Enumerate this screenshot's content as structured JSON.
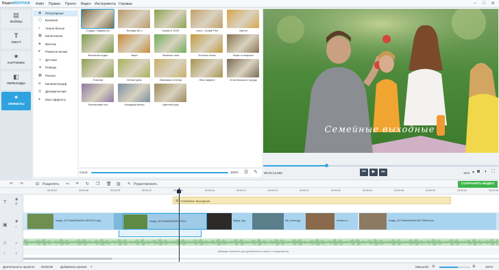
{
  "app": {
    "brand_prefix": "Видео",
    "brand_suffix": "МОНТАЖ",
    "menu": [
      "Файл",
      "Правка",
      "Проект",
      "Видео",
      "Инструменты",
      "Справка"
    ]
  },
  "sidebar": {
    "items": [
      {
        "label": "ФАЙЛЫ",
        "icon": "film-strip-icon"
      },
      {
        "label": "ТЕКСТ",
        "icon": "text-t-icon"
      },
      {
        "label": "КАРТИНКИ",
        "icon": "star-icon"
      },
      {
        "label": "ПЕРЕХОДЫ",
        "icon": "transitions-icon"
      },
      {
        "label": "ЭФФЕКТЫ",
        "icon": "magic-wand-icon"
      }
    ],
    "active": "ЭФФЕКТЫ"
  },
  "categories": [
    {
      "label": "Популярные",
      "icon": "thumb-icon"
    },
    {
      "label": "Базовые",
      "icon": "square-icon"
    },
    {
      "label": "Черно-белые",
      "icon": "circle-half-icon"
    },
    {
      "label": "Кинопленка",
      "icon": "film-icon"
    },
    {
      "label": "Винтаж",
      "icon": "vintage-icon"
    },
    {
      "label": "Романтические",
      "icon": "heart-icon"
    },
    {
      "label": "Детские",
      "icon": "child-icon"
    },
    {
      "label": "Пейзаж",
      "icon": "landscape-icon"
    },
    {
      "label": "Разное",
      "icon": "grid-icon"
    },
    {
      "label": "Кинематограф",
      "icon": "camera-icon"
    },
    {
      "label": "Динамические",
      "icon": "dynamic-icon"
    },
    {
      "label": "Мои эффекты",
      "icon": "user-icon"
    }
  ],
  "effects": [
    {
      "label": "Студия «Эффекты»",
      "color": "#7a6a4a"
    },
    {
      "label": "Фильмы 80-х",
      "color": "#b99a6a"
    },
    {
      "label": "Kodak E-100S",
      "color": "#8ca24e"
    },
    {
      "label": "Lomo - Kodak Film",
      "color": "#c4a06a"
    },
    {
      "label": "Амели",
      "color": "#d6a64a"
    },
    {
      "label": "Весенний отдых",
      "color": "#7c9b4a"
    },
    {
      "label": "Закат",
      "color": "#c78a3a"
    },
    {
      "label": "Зеленые тона",
      "color": "#6fae5a"
    },
    {
      "label": "Золотая осень",
      "color": "#c29a3e"
    },
    {
      "label": "Кофе и сигареты",
      "color": "#8a7350"
    },
    {
      "label": "Позитив",
      "color": "#8ea052"
    },
    {
      "label": "Летний день",
      "color": "#a8b25a"
    },
    {
      "label": "Ламповые оттенки",
      "color": "#c9b06c"
    },
    {
      "label": "Ленс эффект",
      "color": "#a8934e"
    },
    {
      "label": "Огни большого города",
      "color": "#7a6c52"
    },
    {
      "label": "Фиолетовый тон",
      "color": "#8f78a0"
    },
    {
      "label": "Холодный вечер",
      "color": "#7b8ea0"
    },
    {
      "label": "Цветной шум",
      "color": "#9c8a5a"
    }
  ],
  "effects_panel": {
    "strength_label": "Сила:",
    "strength_value": "100%",
    "strength_fraction": 1.0
  },
  "preview": {
    "overlay_text": "Семейные выходные",
    "time_current": "00:00:14.900",
    "aspect": "16:9",
    "progress_fraction": 0.27
  },
  "toolbar": {
    "split_label": "Разделить",
    "edit_label": "Редактировать",
    "save_label": "СОХРАНИТЬ ВИДЕО"
  },
  "timeline": {
    "ticks": [
      "00:00:03",
      "00:00:06",
      "00:00:09",
      "00:00:12",
      "00:00:15",
      "00:00:18",
      "00:00:21",
      "00:00:24",
      "00:00:27",
      "00:00:30",
      "00:00:33",
      "00:00:36",
      "00:00:39",
      "00:00:42",
      "00:00:45"
    ],
    "text_clip": "Семейные выходные",
    "clips": [
      "image_6174ebd95bd034.44676114.jpg",
      "image_6174ebd95bd039.27914",
      "happy-.jpg",
      "fall_chum.jpg",
      "medium-s",
      "image_6174eb9ebb9e9.68779895.mov"
    ],
    "voice_hint": "Дважды кликните для добавления записи с микрофона"
  },
  "status": {
    "duration_label": "Длительность проекта:",
    "duration_value": "00:00:55",
    "clips_label": "Добавлено клипов:",
    "clips_value": "7",
    "zoom_label": "Масштаб:",
    "zoom_value": "167%"
  },
  "colors": {
    "accent": "#2ea3e0",
    "save": "#3cb54a",
    "text_track": "#f6e8b8"
  }
}
